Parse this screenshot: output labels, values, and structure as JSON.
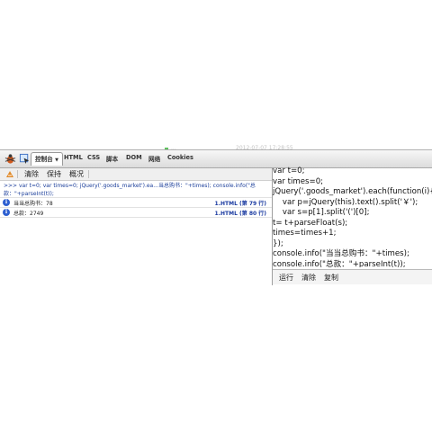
{
  "background_hint": {
    "left": "...",
    "right": "2012-07-07 17:28:55"
  },
  "toolbar": {
    "console_tab": "控制台",
    "tabs": [
      "HTML",
      "CSS",
      "脚本",
      "DOM",
      "网络",
      "Cookies"
    ]
  },
  "console_toolbar": {
    "clear": "清除",
    "persist": "保持",
    "profile": "概况"
  },
  "console": {
    "command": ">>> var t=0; var times=0; jQuery('.goods_market').ea...当总购书：\"+times); console.info(\"总款：\"+parseInt(t));",
    "rows": [
      {
        "text": "当当总购书：78",
        "source": "1.HTML (第 79 行)"
      },
      {
        "text": "总款：2749",
        "source": "1.HTML (第 80 行)"
      }
    ]
  },
  "editor": {
    "lines": [
      "var t=0;",
      "var times=0;",
      "jQuery('.goods_market').each(function(i){",
      "    var p=jQuery(this).text().split('￥');",
      "    var s=p[1].split('(')[0];",
      "t= t+parseFloat(s);",
      "times=times+1;",
      "});",
      "console.info(\"当当总购书：\"+times);",
      "console.info(\"总款：\"+parseInt(t));"
    ],
    "run": "运行",
    "clear": "清除",
    "copy": "复制"
  },
  "colors": {
    "info_icon": "#2d5fd0",
    "command_text": "#1a3d9a",
    "source_link": "#1a3aa0"
  }
}
